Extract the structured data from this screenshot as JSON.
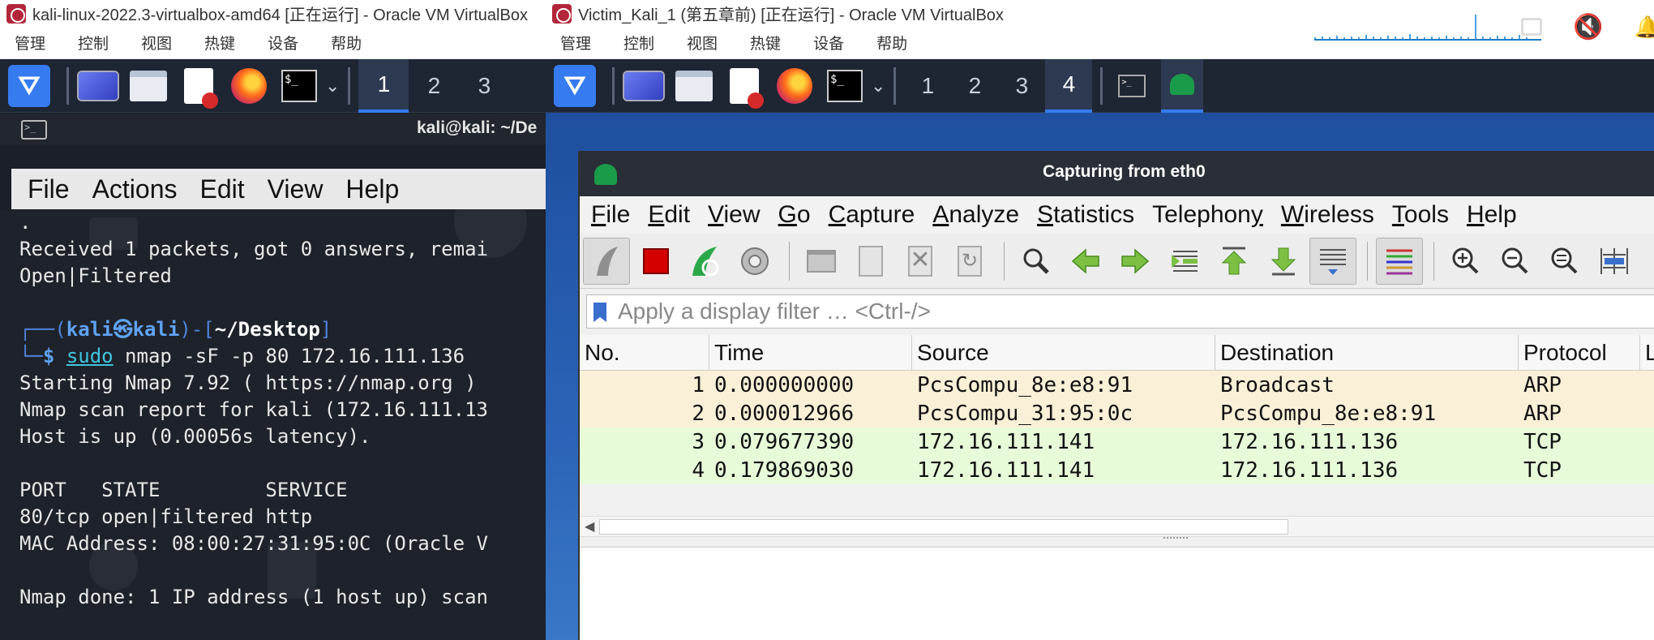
{
  "left_window": {
    "title": "kali-linux-2022.3-virtualbox-amd64 [正在运行] - Oracle VM VirtualBox",
    "menu": [
      "管理",
      "控制",
      "视图",
      "热键",
      "设备",
      "帮助"
    ],
    "workspaces": [
      "1",
      "2",
      "3"
    ],
    "active_workspace": "1",
    "terminal": {
      "title": "kali@kali: ~/De",
      "menu": [
        "File",
        "Actions",
        "Edit",
        "View",
        "Help"
      ],
      "lines": {
        "l0": ".",
        "l1": "Received 1 packets, got 0 answers, remai",
        "l2": "Open|Filtered",
        "l3": "",
        "prompt_open": "┌──(",
        "prompt_user": "kali㉿kali",
        "prompt_mid": ")-[",
        "prompt_path": "~/Desktop",
        "prompt_close": "]",
        "prompt_line2_start": "└─",
        "prompt_dollar": "$ ",
        "cmd_sudo": "sudo",
        "cmd_rest": " nmap -sF -p 80 172.16.111.136",
        "l5": "Starting Nmap 7.92 ( https://nmap.org )",
        "l6": "Nmap scan report for kali (172.16.111.13",
        "l7": "Host is up (0.00056s latency).",
        "l8": "",
        "l9": "PORT   STATE         SERVICE",
        "l10": "80/tcp open|filtered http",
        "l11": "MAC Address: 08:00:27:31:95:0C (Oracle V",
        "l12": "",
        "l13": "Nmap done: 1 IP address (1 host up) scan"
      }
    }
  },
  "right_window": {
    "title": "Victim_Kali_1 (第五章前) [正在运行] - Oracle VM VirtualBox",
    "menu": [
      "管理",
      "控制",
      "视图",
      "热键",
      "设备",
      "帮助"
    ],
    "workspaces": [
      "1",
      "2",
      "3",
      "4"
    ],
    "active_workspace": "4",
    "wireshark": {
      "title": "Capturing from eth0",
      "menu": [
        {
          "u": "F",
          "rest": "ile"
        },
        {
          "u": "E",
          "rest": "dit"
        },
        {
          "u": "V",
          "rest": "iew"
        },
        {
          "u": "G",
          "rest": "o"
        },
        {
          "u": "C",
          "rest": "apture"
        },
        {
          "u": "A",
          "rest": "nalyze"
        },
        {
          "u": "S",
          "rest": "tatistics"
        },
        {
          "u": "",
          "rest": "Telephon",
          "tail_u": "y"
        },
        {
          "u": "W",
          "rest": "ireless"
        },
        {
          "u": "T",
          "rest": "ools"
        },
        {
          "u": "H",
          "rest": "elp"
        }
      ],
      "filter_placeholder": "Apply a display filter … <Ctrl-/>",
      "columns": [
        "No.",
        "Time",
        "Source",
        "Destination",
        "Protocol",
        "L"
      ],
      "packets": [
        {
          "no": "1",
          "time": "0.000000000",
          "source": "PcsCompu_8e:e8:91",
          "destination": "Broadcast",
          "protocol": "ARP"
        },
        {
          "no": "2",
          "time": "0.000012966",
          "source": "PcsCompu_31:95:0c",
          "destination": "PcsCompu_8e:e8:91",
          "protocol": "ARP"
        },
        {
          "no": "3",
          "time": "0.079677390",
          "source": "172.16.111.141",
          "destination": "172.16.111.136",
          "protocol": "TCP"
        },
        {
          "no": "4",
          "time": "0.179869030",
          "source": "172.16.111.141",
          "destination": "172.16.111.136",
          "protocol": "TCP"
        }
      ],
      "colors": {
        "arp_row": "#faf0d7",
        "tcp_row": "#e7fbd9"
      }
    }
  }
}
